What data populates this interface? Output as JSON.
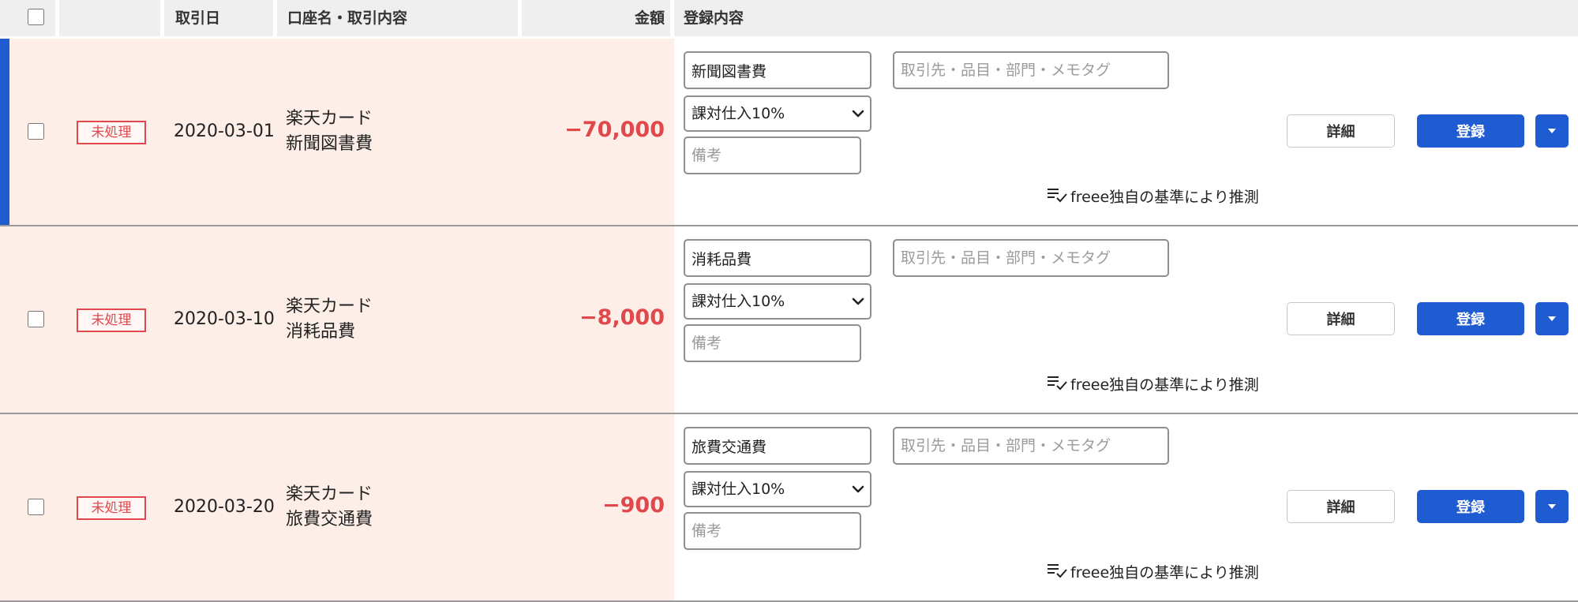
{
  "header": {
    "col_date": "取引日",
    "col_account": "口座名・取引内容",
    "col_amount": "金額",
    "col_registration": "登録内容"
  },
  "rows": [
    {
      "status": "未処理",
      "date": "2020-03-01",
      "account_name": "楽天カード",
      "description": "新聞図書費",
      "amount": "−70,000",
      "category": "新聞図書費",
      "tag_placeholder": "取引先・品目・部門・メモタグ",
      "tax": "課対仕入10%",
      "memo_placeholder": "備考",
      "guess": "freee独自の基準により推測",
      "detail_label": "詳細",
      "register_label": "登録",
      "active": true
    },
    {
      "status": "未処理",
      "date": "2020-03-10",
      "account_name": "楽天カード",
      "description": "消耗品費",
      "amount": "−8,000",
      "category": "消耗品費",
      "tag_placeholder": "取引先・品目・部門・メモタグ",
      "tax": "課対仕入10%",
      "memo_placeholder": "備考",
      "guess": "freee独自の基準により推測",
      "detail_label": "詳細",
      "register_label": "登録",
      "active": false
    },
    {
      "status": "未処理",
      "date": "2020-03-20",
      "account_name": "楽天カード",
      "description": "旅費交通費",
      "amount": "−900",
      "category": "旅費交通費",
      "tag_placeholder": "取引先・品目・部門・メモタグ",
      "tax": "課対仕入10%",
      "memo_placeholder": "備考",
      "guess": "freee独自の基準により推測",
      "detail_label": "詳細",
      "register_label": "登録",
      "active": false
    }
  ],
  "colors": {
    "accent": "#1f5bd1",
    "status_red": "#e0484b",
    "row_pink": "#fdeee8",
    "header_bg": "#efefef"
  },
  "icons": {
    "select_arrow": "chevron-down-icon",
    "guess": "list-check-icon",
    "dropdown": "caret-down-icon"
  }
}
